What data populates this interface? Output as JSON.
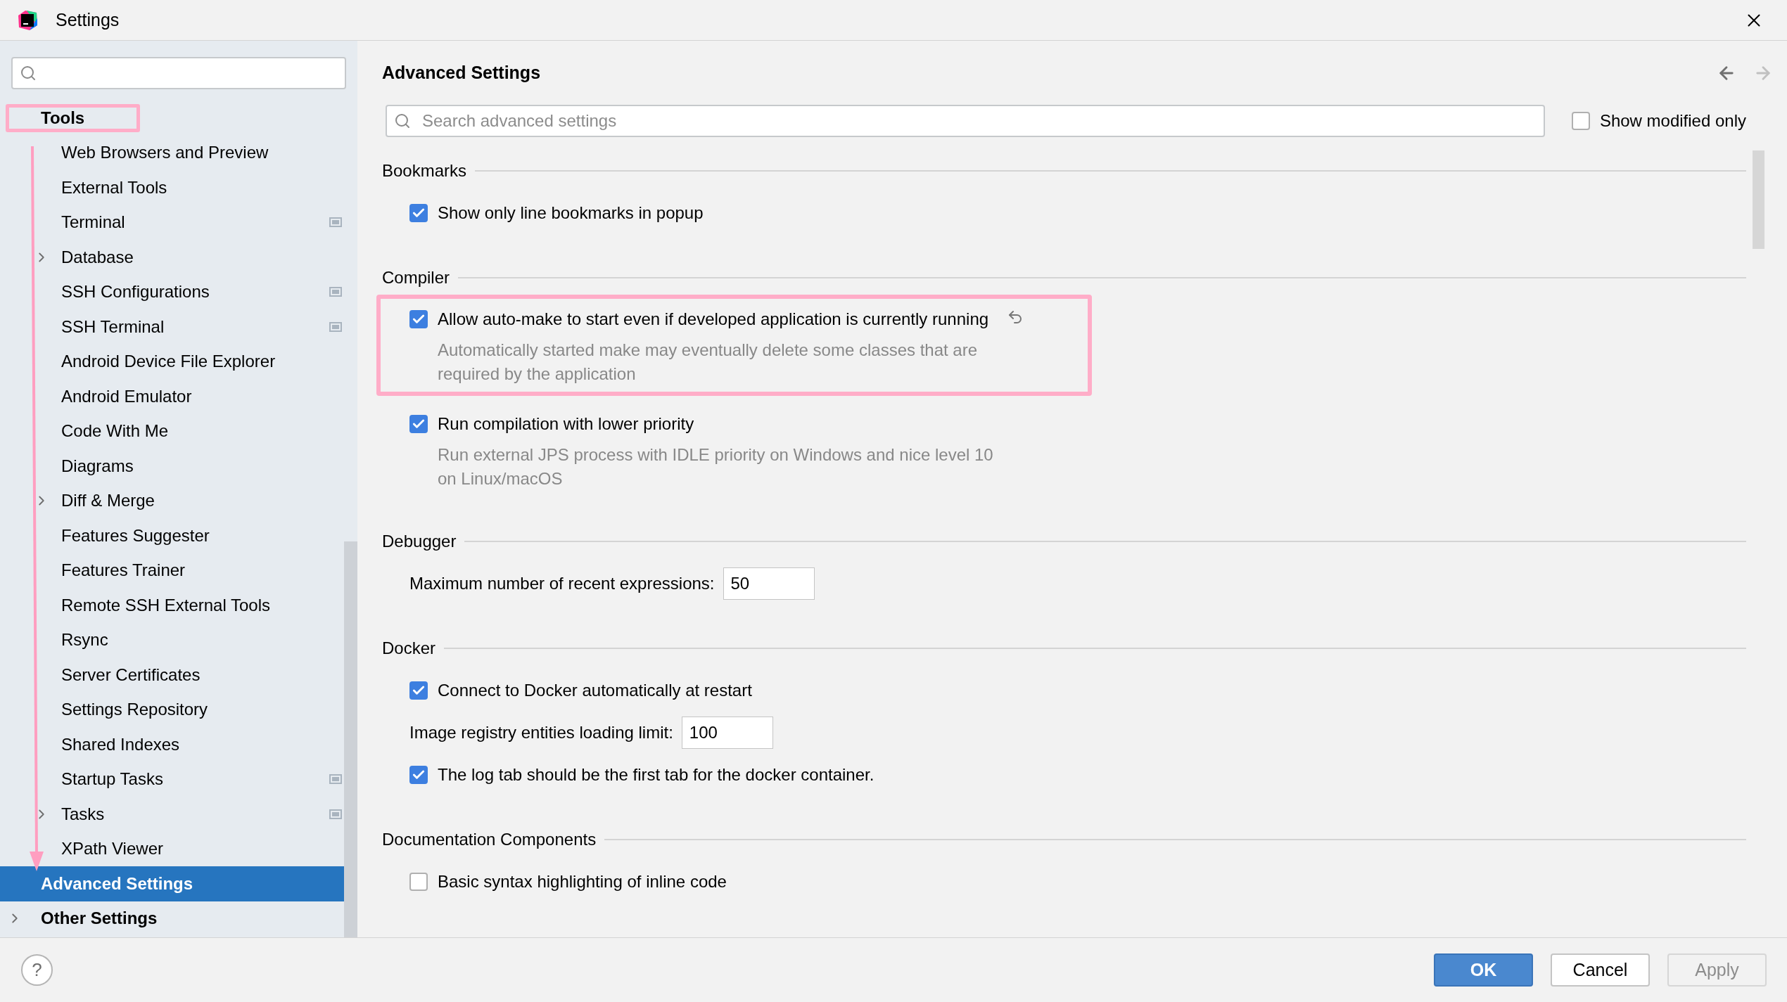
{
  "window": {
    "title": "Settings"
  },
  "sidebar": {
    "items": [
      {
        "label": "Tools",
        "annotated": true,
        "selected": false,
        "expandable": false,
        "children": [
          {
            "label": "Web Browsers and Preview",
            "expandable": false,
            "project_level": false,
            "selected": false
          },
          {
            "label": "External Tools",
            "expandable": false,
            "project_level": false,
            "selected": false
          },
          {
            "label": "Terminal",
            "expandable": false,
            "project_level": true,
            "selected": false
          },
          {
            "label": "Database",
            "expandable": true,
            "project_level": false,
            "selected": false
          },
          {
            "label": "SSH Configurations",
            "expandable": false,
            "project_level": true,
            "selected": false
          },
          {
            "label": "SSH Terminal",
            "expandable": false,
            "project_level": true,
            "selected": false
          },
          {
            "label": "Android Device File Explorer",
            "expandable": false,
            "project_level": false,
            "selected": false
          },
          {
            "label": "Android Emulator",
            "expandable": false,
            "project_level": false,
            "selected": false
          },
          {
            "label": "Code With Me",
            "expandable": false,
            "project_level": false,
            "selected": false
          },
          {
            "label": "Diagrams",
            "expandable": false,
            "project_level": false,
            "selected": false
          },
          {
            "label": "Diff & Merge",
            "expandable": true,
            "project_level": false,
            "selected": false
          },
          {
            "label": "Features Suggester",
            "expandable": false,
            "project_level": false,
            "selected": false
          },
          {
            "label": "Features Trainer",
            "expandable": false,
            "project_level": false,
            "selected": false
          },
          {
            "label": "Remote SSH External Tools",
            "expandable": false,
            "project_level": false,
            "selected": false
          },
          {
            "label": "Rsync",
            "expandable": false,
            "project_level": false,
            "selected": false
          },
          {
            "label": "Server Certificates",
            "expandable": false,
            "project_level": false,
            "selected": false
          },
          {
            "label": "Settings Repository",
            "expandable": false,
            "project_level": false,
            "selected": false
          },
          {
            "label": "Shared Indexes",
            "expandable": false,
            "project_level": false,
            "selected": false
          },
          {
            "label": "Startup Tasks",
            "expandable": false,
            "project_level": true,
            "selected": false
          },
          {
            "label": "Tasks",
            "expandable": true,
            "project_level": true,
            "selected": false
          },
          {
            "label": "XPath Viewer",
            "expandable": false,
            "project_level": false,
            "selected": false
          }
        ]
      },
      {
        "label": "Advanced Settings",
        "annotated": false,
        "selected": true,
        "expandable": false
      },
      {
        "label": "Other Settings",
        "annotated": false,
        "selected": false,
        "expandable": true
      }
    ]
  },
  "header": {
    "title": "Advanced Settings",
    "back_enabled": true,
    "forward_enabled": false
  },
  "search": {
    "placeholder": "Search advanced settings"
  },
  "show_modified_only": {
    "label": "Show modified only",
    "checked": false
  },
  "sections": [
    {
      "title": "Bookmarks",
      "items": [
        {
          "kind": "checkbox",
          "label": "Show only line bookmarks in popup",
          "checked": true,
          "annotated": false,
          "modified": false
        }
      ]
    },
    {
      "title": "Compiler",
      "items": [
        {
          "kind": "checkbox",
          "label": "Allow auto-make to start even if developed application is currently running",
          "description": "Automatically started make may eventually delete some classes that are required by the application",
          "checked": true,
          "annotated": true,
          "modified": true
        },
        {
          "kind": "checkbox",
          "label": "Run compilation with lower priority",
          "description": "Run external JPS process with IDLE priority on Windows and nice level 10 on Linux/macOS",
          "checked": true,
          "annotated": false,
          "modified": false
        }
      ]
    },
    {
      "title": "Debugger",
      "items": [
        {
          "kind": "number",
          "label": "Maximum number of recent expressions:",
          "value": "50",
          "annotated": false,
          "modified": false
        }
      ]
    },
    {
      "title": "Docker",
      "items": [
        {
          "kind": "checkbox",
          "label": "Connect to Docker automatically at restart",
          "checked": true,
          "annotated": false,
          "modified": false
        },
        {
          "kind": "number",
          "label": "Image registry entities loading limit:",
          "value": "100",
          "annotated": false,
          "modified": false
        },
        {
          "kind": "checkbox",
          "label": "The log tab should be the first tab for the docker container.",
          "checked": true,
          "annotated": false,
          "modified": false
        }
      ]
    },
    {
      "title": "Documentation Components",
      "items": [
        {
          "kind": "checkbox",
          "label": "Basic syntax highlighting of inline code",
          "checked": false,
          "annotated": false,
          "modified": false
        }
      ]
    }
  ],
  "help_button": "?",
  "buttons": [
    {
      "label": "OK",
      "kind": "primary",
      "disabled": false
    },
    {
      "label": "Cancel",
      "kind": "default",
      "disabled": false
    },
    {
      "label": "Apply",
      "kind": "default",
      "disabled": true
    }
  ]
}
